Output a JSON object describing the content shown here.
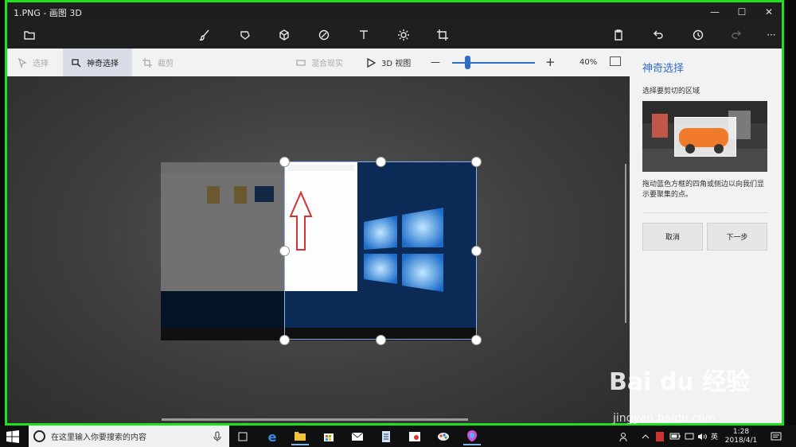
{
  "window": {
    "title": "1.PNG - 画图 3D"
  },
  "title_controls": {
    "minimize": "—",
    "maximize": "☐",
    "close": "✕"
  },
  "toolbar": {
    "icons": [
      "folder-icon",
      "brush-icon",
      "2d-shapes-icon",
      "3d-shapes-icon",
      "stickers-icon",
      "text-icon",
      "effects-icon",
      "canvas-icon",
      "paste-icon",
      "undo-icon",
      "history-icon",
      "redo-icon",
      "more-icon"
    ],
    "more_label": "···"
  },
  "subbar": {
    "select_label": "选择",
    "magic_select_label": "神奇选择",
    "crop_label": "裁剪",
    "mixed_reality_label": "混合现实",
    "view3d_label": "3D 视图",
    "zoom_minus": "—",
    "zoom_plus": "+",
    "zoom_percent": "40%",
    "zoom_level": 0.15
  },
  "panel": {
    "title": "神奇选择",
    "subtitle": "选择要剪切的区域",
    "description": "拖动蓝色方框的四角或侧边以向我们显示要聚集的点。",
    "cancel_label": "取消",
    "next_label": "下一步"
  },
  "taskbar": {
    "search_placeholder": "在这里输入你要搜索的内容",
    "time": "1:28",
    "date": "2018/4/1",
    "ime": "英",
    "colors": {
      "accent": "#7cb8f0"
    }
  },
  "watermark": {
    "brand": "Bai du 经验",
    "site": "jingyan.baidu.com"
  },
  "colors": {
    "frame": "#1ee11e",
    "accent": "#2f6ec7"
  }
}
